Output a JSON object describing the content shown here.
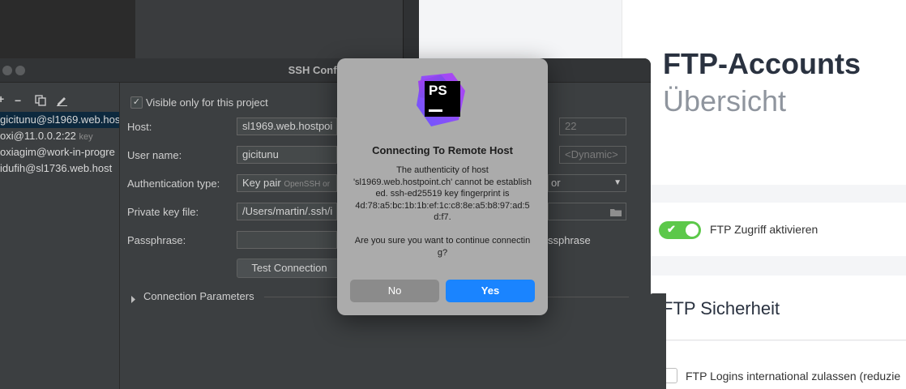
{
  "colors": {
    "toggle_on": "#5cc84a",
    "primary_button": "#1a84ff",
    "ide_background": "#3c3f41",
    "selection": "#0d293e"
  },
  "web": {
    "title": "FTP-Accounts",
    "subtitle": "Übersicht",
    "toggle_label": "FTP Zugriff aktivieren",
    "toggle_state": "on",
    "security_title": "FTP Sicherheit",
    "intl_label": "FTP Logins international zulassen (reduzie"
  },
  "ssh": {
    "title": "SSH Configura",
    "toolbar": {
      "add_icon": "plus-icon",
      "remove_label": "−",
      "copy_icon": "copy-icon",
      "edit_icon": "pencil-icon"
    },
    "hosts": [
      {
        "label": "gicitunu@sl1969.web.host",
        "note": ""
      },
      {
        "label": "oxi@11.0.0.2:22",
        "note": "key"
      },
      {
        "label": "oxiagim@work-in-progre",
        "note": ""
      },
      {
        "label": "idufih@sl1736.web.host",
        "note": ""
      }
    ],
    "visible_only_label": "Visible only for this project",
    "host_label": "Host:",
    "host_value": "sl1969.web.hostpoi",
    "port_value": "22",
    "username_label": "User name:",
    "username_value": "gicitunu",
    "local_port_placeholder": "<Dynamic>",
    "auth_label": "Authentication type:",
    "auth_value": "Key pair",
    "auth_sub": "OpenSSH or",
    "auth_suffix": "or",
    "keyfile_label": "Private key file:",
    "keyfile_value": "/Users/martin/.ssh/i",
    "passphrase_label": "Passphrase:",
    "save_passphrase_label": "ssphrase",
    "test_button": "Test Connection",
    "conn_params": "Connection Parameters"
  },
  "dialog": {
    "title": "Connecting To Remote Host",
    "message": "The authenticity of host\n'sl1969.web.hostpoint.ch' cannot be established. ssh-ed25519 key fingerprint is\n4d:78:a5:bc:1b:1b:ef:1c:c8:8e:a5:b8:97:ad:5d:f7.\n\nAre you sure you want to continue connecting?",
    "no_label": "No",
    "yes_label": "Yes",
    "logo_text": "PS"
  }
}
